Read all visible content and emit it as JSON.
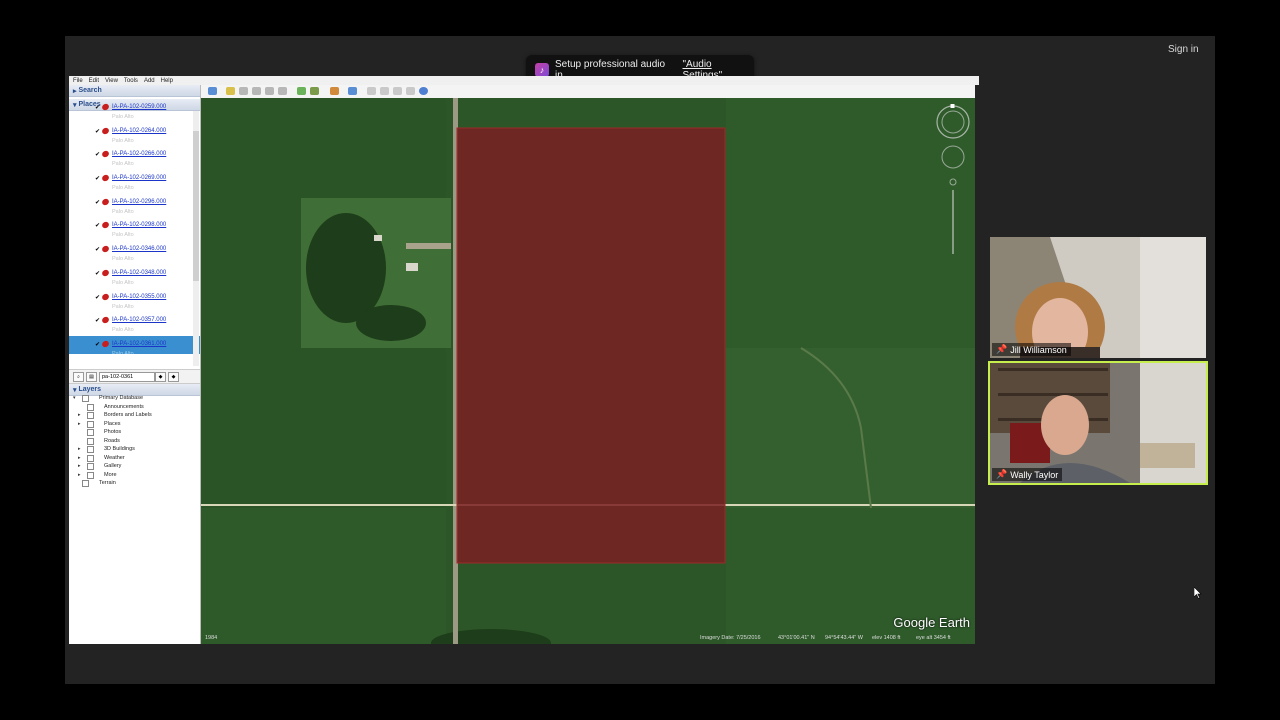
{
  "meeting": {
    "sign_in": "Sign in",
    "toast": {
      "text": "Setup professional audio in",
      "link": "\"Audio Settings\""
    },
    "participants": [
      {
        "name": "Jill Williamson"
      },
      {
        "name": "Wally Taylor"
      }
    ]
  },
  "google_earth": {
    "menu": [
      "File",
      "Edit",
      "View",
      "Tools",
      "Add",
      "Help"
    ],
    "search_header": "Search",
    "places_header": "Places",
    "places": [
      {
        "name": "IA-PA-102-0259.000",
        "sub": "Palo Alto",
        "checked": "✔"
      },
      {
        "name": "IA-PA-102-0264.000",
        "sub": "Palo Alto",
        "checked": "✔"
      },
      {
        "name": "IA-PA-102-0266.000",
        "sub": "Palo Alto",
        "checked": "✔"
      },
      {
        "name": "IA-PA-102-0269.000",
        "sub": "Palo Alto",
        "checked": "✔"
      },
      {
        "name": "IA-PA-102-0296.000",
        "sub": "Palo Alto",
        "checked": "✔"
      },
      {
        "name": "IA-PA-102-0298.000",
        "sub": "Palo Alto",
        "checked": "✔"
      },
      {
        "name": "IA-PA-102-0346.000",
        "sub": "Palo Alto",
        "checked": "✔"
      },
      {
        "name": "IA-PA-102-0348.000",
        "sub": "Palo Alto",
        "checked": "✔"
      },
      {
        "name": "IA-PA-102-0355.000",
        "sub": "Palo Alto",
        "checked": "✔"
      },
      {
        "name": "IA-PA-102-0357.000",
        "sub": "Palo Alto",
        "checked": "✔"
      },
      {
        "name": "IA-PA-102-0361.000",
        "sub": "Palo Alto",
        "checked": "✔"
      }
    ],
    "search_value": "pa-102-0361",
    "layers_header": "Layers",
    "layers": [
      {
        "label": "Primary Database",
        "level": 0,
        "arrow": "▾"
      },
      {
        "label": "Announcements",
        "level": 1,
        "arrow": ""
      },
      {
        "label": "Borders and Labels",
        "level": 1,
        "arrow": "▸"
      },
      {
        "label": "Places",
        "level": 1,
        "arrow": "▸"
      },
      {
        "label": "Photos",
        "level": 1,
        "arrow": ""
      },
      {
        "label": "Roads",
        "level": 1,
        "arrow": ""
      },
      {
        "label": "3D Buildings",
        "level": 1,
        "arrow": "▸"
      },
      {
        "label": "Weather",
        "level": 1,
        "arrow": "▸"
      },
      {
        "label": "Gallery",
        "level": 1,
        "arrow": "▸"
      },
      {
        "label": "More",
        "level": 1,
        "arrow": "▸"
      },
      {
        "label": "Terrain",
        "level": 0,
        "arrow": ""
      }
    ],
    "watermark": "Google Earth",
    "status": {
      "imagery_date": "Imagery Date: 7/25/2016",
      "lat": "43°01'00.41\" N",
      "lon": "94°54'43.44\" W",
      "elev": "elev  1408 ft",
      "eye_alt": "eye alt   3454 ft",
      "scale": "1984"
    }
  },
  "colors": {
    "highlight_border": "#c6ef4e",
    "parcel_fill": "#7a1e22"
  }
}
